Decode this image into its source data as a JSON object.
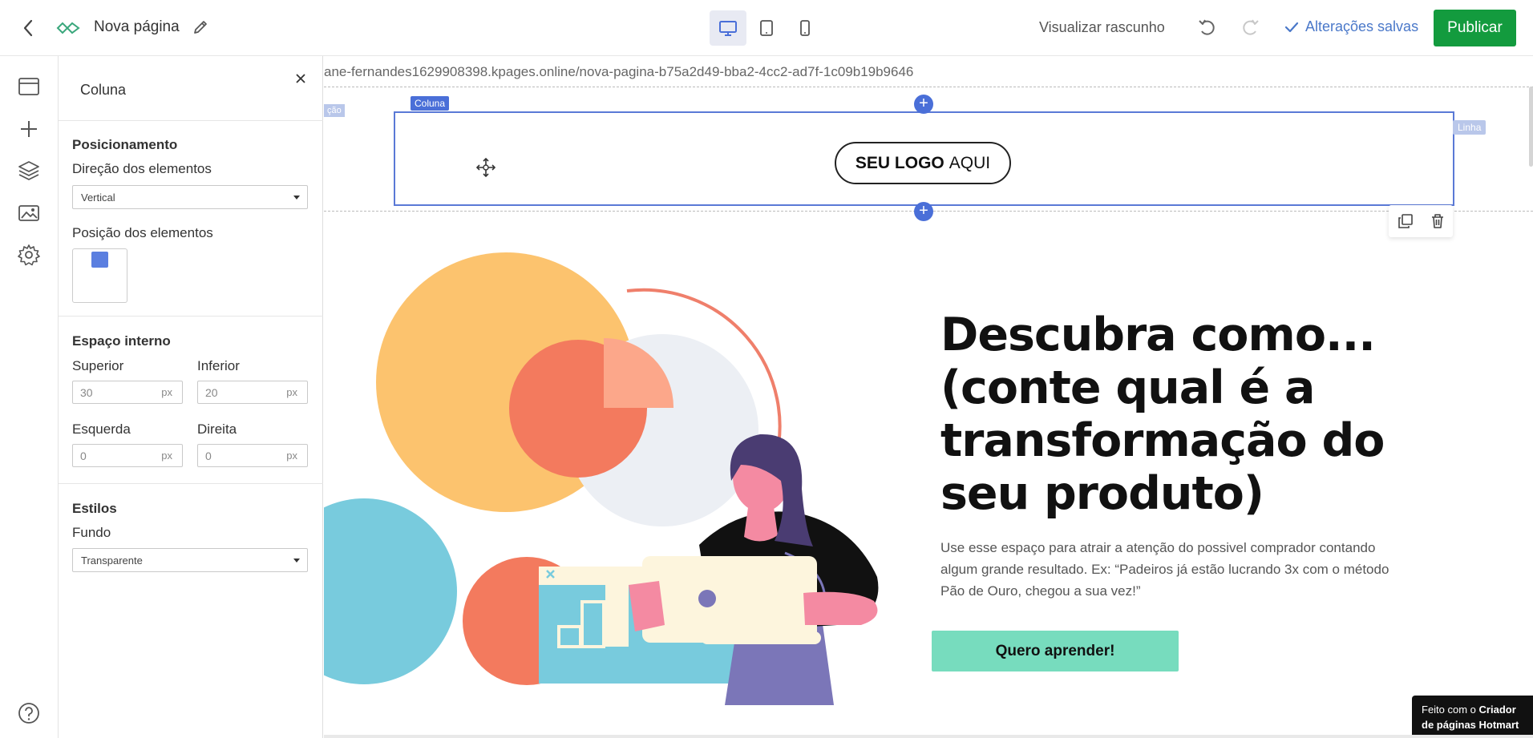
{
  "topbar": {
    "page_title": "Nova página",
    "preview_label": "Visualizar rascunho",
    "saved_label": "Alterações salvas",
    "publish_label": "Publicar",
    "active_device": "desktop"
  },
  "rail": {
    "items": [
      {
        "icon": "page-icon"
      },
      {
        "icon": "add-icon"
      },
      {
        "icon": "layers-icon"
      },
      {
        "icon": "image-icon"
      },
      {
        "icon": "gear-icon"
      },
      {
        "icon": "help-icon"
      }
    ]
  },
  "panel": {
    "title": "Coluna",
    "positioning": {
      "title": "Posicionamento",
      "direction_label": "Direção dos elementos",
      "direction_value": "Vertical",
      "position_label": "Posição dos elementos"
    },
    "padding": {
      "title": "Espaço interno",
      "top_label": "Superior",
      "top_value": "30",
      "bottom_label": "Inferior",
      "bottom_value": "20",
      "left_label": "Esquerda",
      "left_value": "0",
      "right_label": "Direita",
      "right_value": "0",
      "unit": "px"
    },
    "styles": {
      "title": "Estilos",
      "background_label": "Fundo",
      "background_value": "Transparente"
    }
  },
  "canvas": {
    "url": "ane-fernandes1629908398.kpages.online/nova-pagina-b75a2d49-bba2-4cc2-ad7f-1c09b19b9646",
    "section_tag": "ção",
    "column_tag": "Coluna",
    "line_tag": "Linha",
    "logo_bold": "SEU LOGO",
    "logo_rest": "AQUI",
    "hero_title": "Descubra como... (conte qual é a transformação do seu produto)",
    "hero_subtitle": "Use esse espaço para atrair a atenção do possivel comprador contando algum grande resultado. Ex: “Padeiros já estão lucrando 3x com o método Pão de Ouro, chegou a sua vez!”",
    "cta_label": "Quero aprender!",
    "badge_prefix": "Feito com o",
    "badge_bold": "Criador de páginas Hotmart"
  },
  "colors": {
    "accent": "#4a6fd8",
    "publish": "#139b3e",
    "cta": "#77dcbe",
    "saved": "#4a78c9"
  }
}
